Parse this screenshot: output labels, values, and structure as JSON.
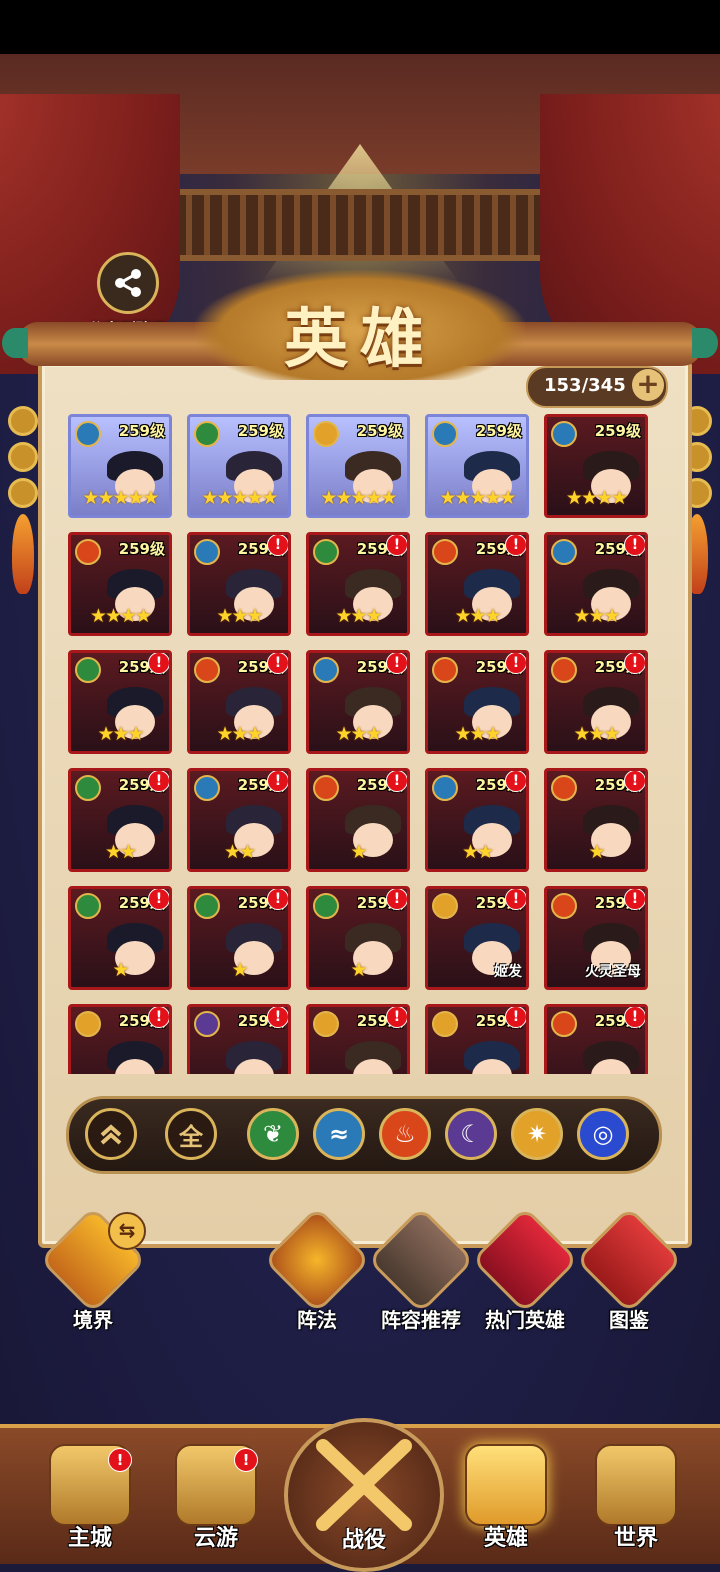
{
  "screen": {
    "title": "英雄",
    "share_label": "分享到聊天",
    "hero_count": "153/345",
    "add_symbol": "+"
  },
  "heroes": [
    {
      "level": "259级",
      "element": "water",
      "stars": "★★★★★",
      "name": "",
      "alert": false,
      "frame": "blue"
    },
    {
      "level": "259级",
      "element": "wood",
      "stars": "★★★★★",
      "name": "",
      "alert": false,
      "frame": "blue"
    },
    {
      "level": "259级",
      "element": "light",
      "stars": "★★★★★",
      "name": "",
      "alert": false,
      "frame": "blue"
    },
    {
      "level": "259级",
      "element": "water",
      "stars": "★★★★★",
      "name": "",
      "alert": false,
      "frame": "blue"
    },
    {
      "level": "259级",
      "element": "water",
      "stars": "★★★★",
      "name": "",
      "alert": false,
      "frame": "red"
    },
    {
      "level": "259级",
      "element": "fire",
      "stars": "★★★★",
      "name": "",
      "alert": false,
      "frame": "red"
    },
    {
      "level": "259级",
      "element": "water",
      "stars": "★★★",
      "name": "",
      "alert": true,
      "frame": "red"
    },
    {
      "level": "259级",
      "element": "wood",
      "stars": "★★★",
      "name": "",
      "alert": true,
      "frame": "red"
    },
    {
      "level": "259级",
      "element": "fire",
      "stars": "★★★",
      "name": "",
      "alert": true,
      "frame": "red"
    },
    {
      "level": "259级",
      "element": "water",
      "stars": "★★★",
      "name": "",
      "alert": true,
      "frame": "red"
    },
    {
      "level": "259级",
      "element": "wood",
      "stars": "★★★",
      "name": "",
      "alert": true,
      "frame": "red"
    },
    {
      "level": "259级",
      "element": "fire",
      "stars": "★★★",
      "name": "",
      "alert": true,
      "frame": "red"
    },
    {
      "level": "259级",
      "element": "water",
      "stars": "★★★",
      "name": "",
      "alert": true,
      "frame": "red"
    },
    {
      "level": "259级",
      "element": "fire",
      "stars": "★★★",
      "name": "",
      "alert": true,
      "frame": "red"
    },
    {
      "level": "259级",
      "element": "fire",
      "stars": "★★★",
      "name": "",
      "alert": true,
      "frame": "red"
    },
    {
      "level": "259级",
      "element": "wood",
      "stars": "★★",
      "name": "",
      "alert": true,
      "frame": "red"
    },
    {
      "level": "259级",
      "element": "water",
      "stars": "★★",
      "name": "",
      "alert": true,
      "frame": "red"
    },
    {
      "level": "259级",
      "element": "fire",
      "stars": "★",
      "name": "",
      "alert": true,
      "frame": "red"
    },
    {
      "level": "259级",
      "element": "water",
      "stars": "★★",
      "name": "",
      "alert": true,
      "frame": "red"
    },
    {
      "level": "259级",
      "element": "fire",
      "stars": "★",
      "name": "",
      "alert": true,
      "frame": "red"
    },
    {
      "level": "259级",
      "element": "wood",
      "stars": "★",
      "name": "",
      "alert": true,
      "frame": "red"
    },
    {
      "level": "259级",
      "element": "wood",
      "stars": "★",
      "name": "",
      "alert": true,
      "frame": "red"
    },
    {
      "level": "259级",
      "element": "wood",
      "stars": "★",
      "name": "",
      "alert": true,
      "frame": "red"
    },
    {
      "level": "259级",
      "element": "light",
      "stars": "",
      "name": "姬发",
      "alert": true,
      "frame": "red"
    },
    {
      "level": "259级",
      "element": "fire",
      "stars": "",
      "name": "火灵圣母",
      "alert": true,
      "frame": "red"
    },
    {
      "level": "259级",
      "element": "light",
      "stars": "",
      "name": "",
      "alert": true,
      "frame": "red"
    },
    {
      "level": "259级",
      "element": "dark",
      "stars": "",
      "name": "",
      "alert": true,
      "frame": "red"
    },
    {
      "level": "259级",
      "element": "light",
      "stars": "",
      "name": "",
      "alert": true,
      "frame": "red"
    },
    {
      "level": "259级",
      "element": "light",
      "stars": "",
      "name": "",
      "alert": true,
      "frame": "red"
    },
    {
      "level": "259级",
      "element": "fire",
      "stars": "",
      "name": "",
      "alert": true,
      "frame": "red"
    }
  ],
  "filters": {
    "collapse_icon": "double-chevron-up-icon",
    "all_label": "全",
    "elements": [
      "wood",
      "water",
      "fire",
      "dark",
      "light",
      "wind"
    ]
  },
  "side_buttons": {
    "realm": "境界",
    "formation": "阵法",
    "lineup": "阵容推荐",
    "hot_heroes": "热门英雄",
    "codex": "图鉴",
    "swap_symbol": "⇆"
  },
  "nav": {
    "main_city": "主城",
    "travel": "云游",
    "battle": "战役",
    "heroes": "英雄",
    "world": "世界",
    "alert_symbol": "!"
  },
  "colors": {
    "wood": "#2e8a3c",
    "water": "#2a7ab8",
    "fire": "#d8461a",
    "dark": "#5a3a92",
    "light": "#e2a22a",
    "wind": "#2a4ad0"
  }
}
